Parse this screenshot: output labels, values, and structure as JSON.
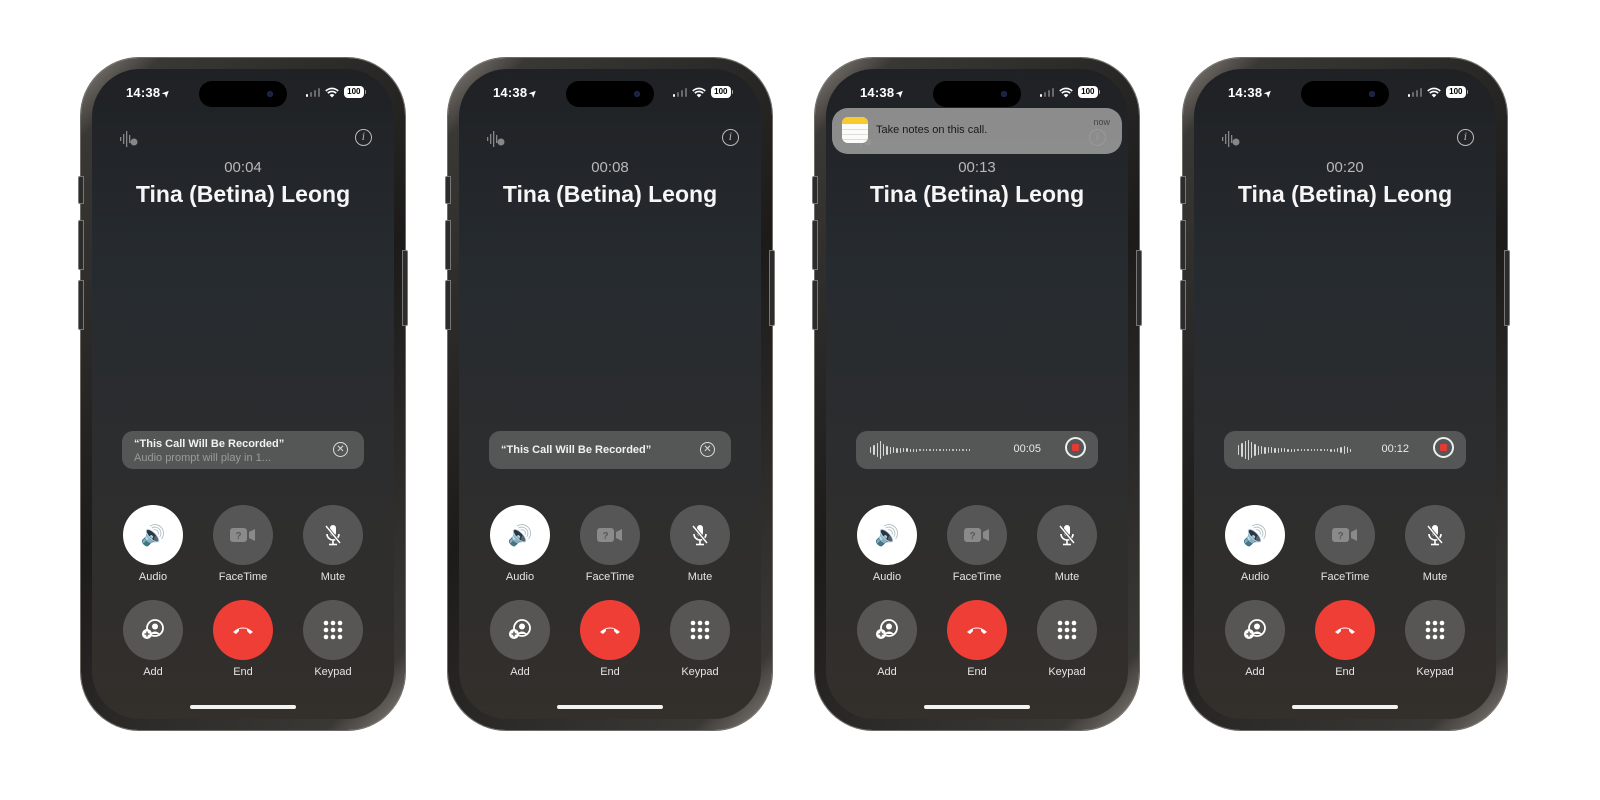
{
  "status_bar": {
    "time": "14:38",
    "location_icon": "location-arrow-icon",
    "battery": "100"
  },
  "phones": [
    {
      "timer": "00:04",
      "caller": "Tina (Betina) Leong",
      "banner": {
        "type": "prompt",
        "title": "“This Call Will Be Recorded”",
        "subtitle": "Audio prompt will play in 1..."
      }
    },
    {
      "timer": "00:08",
      "caller": "Tina (Betina) Leong",
      "banner": {
        "type": "prompt",
        "title": "“This Call Will Be Recorded”"
      }
    },
    {
      "timer": "00:13",
      "caller": "Tina (Betina) Leong",
      "notification": {
        "app_icon": "notes-app-icon",
        "message": "Take notes on this call.",
        "time": "now"
      },
      "banner": {
        "type": "recording",
        "elapsed": "00:05"
      }
    },
    {
      "timer": "00:20",
      "caller": "Tina (Betina) Leong",
      "banner": {
        "type": "recording",
        "elapsed": "00:12"
      }
    }
  ],
  "controls": {
    "audio": "Audio",
    "facetime": "FaceTime",
    "mute": "Mute",
    "add": "Add",
    "end": "End",
    "keypad": "Keypad"
  },
  "colors": {
    "end_call": "#ef3e36",
    "stop_record": "#e53935",
    "notes_yellow": "#f7cb2d"
  }
}
